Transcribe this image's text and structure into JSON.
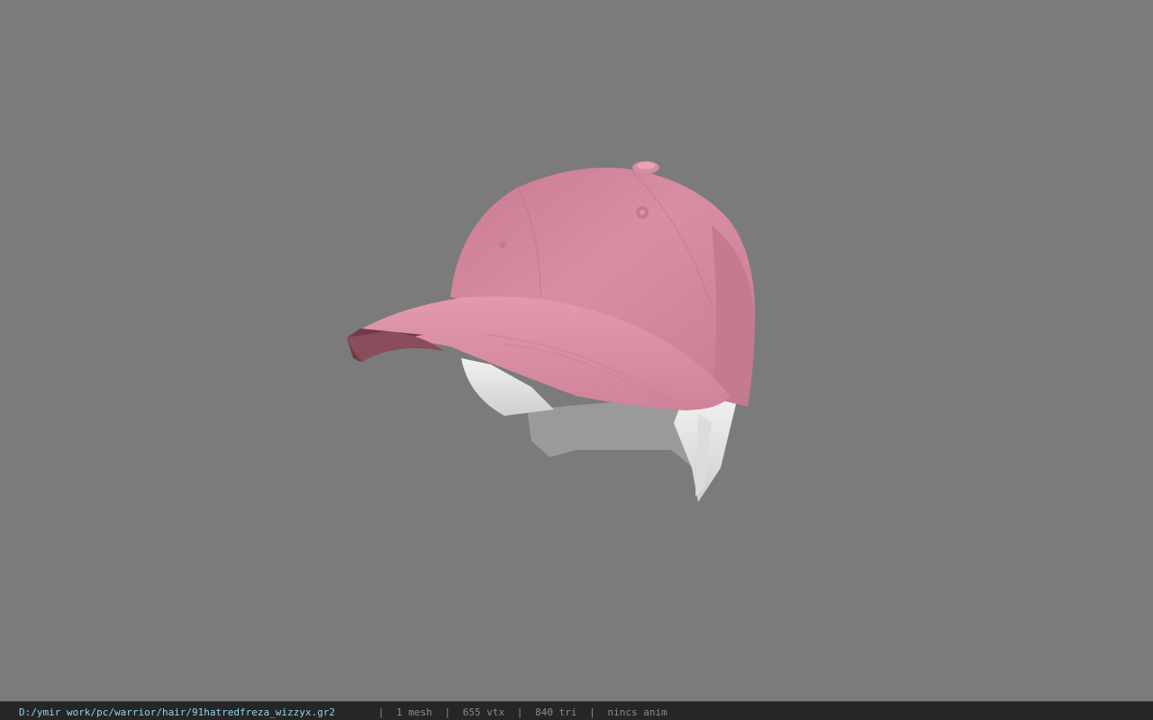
{
  "viewport": {
    "background": "#7b7b7b",
    "model_name": "pink baseball cap with hair"
  },
  "statusbar": {
    "path": "D:/ymir work/pc/warrior/hair/91hatredfreza_wizzyx.gr2",
    "mesh": "1 mesh",
    "vtx": "655 vtx",
    "tri": "840 tri",
    "anim": "nincs anim",
    "separator": "|",
    "path_color": "#8fd3ec",
    "stats_color": "#8c8c8c"
  }
}
